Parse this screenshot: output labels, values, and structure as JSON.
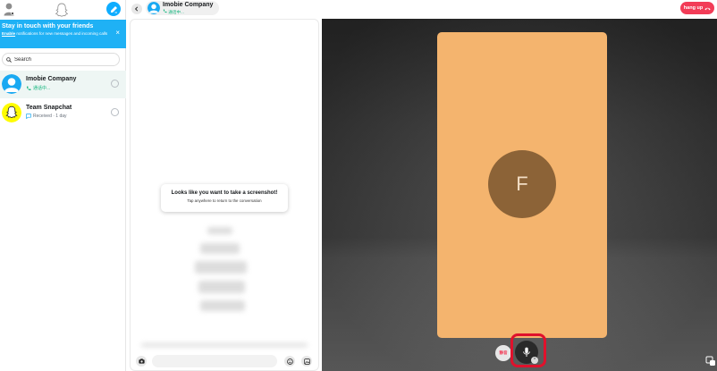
{
  "app": {
    "accent": "#0fadff",
    "hangup_color": "#f23c57",
    "highlight_color": "#e0112c"
  },
  "notification": {
    "title": "Stay in touch with your friends",
    "enable_link": "Enable",
    "body": " notifications for new messages and incoming calls",
    "close": "×"
  },
  "search": {
    "placeholder": "Search"
  },
  "chats": [
    {
      "name": "Imobie Company",
      "status": "通话中...",
      "status_color": "#11b57c",
      "icon": "phone-icon",
      "active": true
    },
    {
      "name": "Team Snapchat",
      "status": "Received · 1 day",
      "status_color": "#656d78",
      "icon": "chat-bubble-icon",
      "active": false
    }
  ],
  "conversation": {
    "name": "Imobie Company",
    "status": "通话中...",
    "toast_title": "Looks like you want to take a screenshot!",
    "toast_sub": "Tap anywhere to return to the conversation",
    "input_placeholder": ""
  },
  "call": {
    "hangup_label": "hang up",
    "avatar_letter": "F",
    "tile_color": "#f4b46e",
    "avatar_color": "#8c6337",
    "left_control_label": "静音",
    "mic_chevron": "^"
  }
}
